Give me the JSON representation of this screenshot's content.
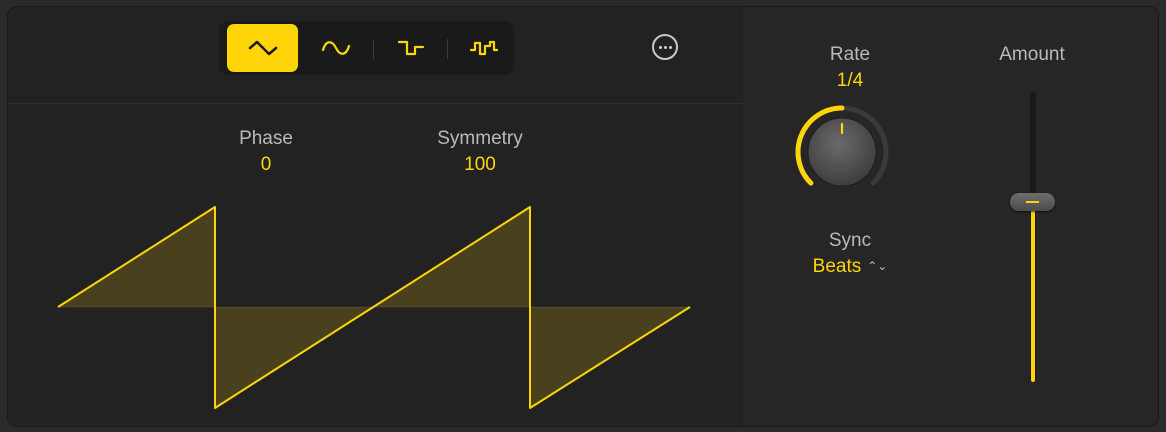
{
  "shape_buttons": [
    {
      "icon": "triangle-wave-icon",
      "selected": true
    },
    {
      "icon": "sine-wave-icon",
      "selected": false
    },
    {
      "icon": "square-wave-icon",
      "selected": false
    },
    {
      "icon": "random-step-wave-icon",
      "selected": false
    }
  ],
  "more_icon": "ellipsis-circle-icon",
  "phase": {
    "label": "Phase",
    "value": "0"
  },
  "symmetry": {
    "label": "Symmetry",
    "value": "100"
  },
  "rate": {
    "label": "Rate",
    "value": "1/4",
    "knob_level": 0.5
  },
  "sync": {
    "label": "Sync",
    "value": "Beats",
    "caret_icon": "up-down-chevron-icon"
  },
  "amount": {
    "label": "Amount",
    "level": 0.62
  },
  "colors": {
    "accent": "#ffd50a",
    "background": "#222222",
    "panel_right": "#262626"
  }
}
